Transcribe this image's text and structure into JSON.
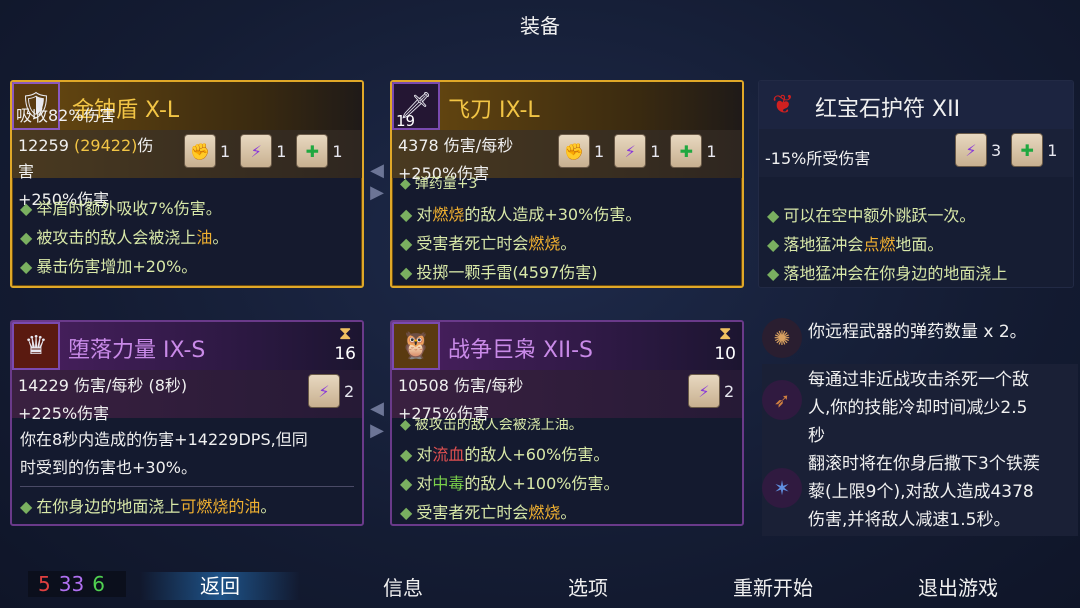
{
  "screen_title": "装备",
  "cards": {
    "shield": {
      "icon": "gold-shield-icon",
      "title": "金钟盾",
      "tier": "X-L",
      "overlay_text": "吸收82%伤害",
      "stat_base": "12259",
      "stat_boost": "(29422)",
      "stat_suffix": "伤",
      "stat_wrap": "害",
      "stat_line2": "+250%伤害",
      "scrolls": [
        {
          "icon": "scroll-red",
          "count": "1"
        },
        {
          "icon": "scroll-purple",
          "count": "1"
        },
        {
          "icon": "scroll-green",
          "count": "1"
        }
      ],
      "bullets": [
        {
          "pre": "举盾时额外吸收7%伤害。",
          "kw": "",
          "post": ""
        },
        {
          "pre": "被攻击的敌人会被浇上",
          "kw": "油",
          "post": "。"
        },
        {
          "pre": "暴击伤害增加+20%。",
          "kw": "",
          "post": ""
        }
      ]
    },
    "knife": {
      "icon": "throwing-knife-icon",
      "icon_count": "19",
      "title": "飞刀",
      "tier": "IX-L",
      "stat_line1": "4378 伤害/每秒",
      "stat_line2": "+250%伤害",
      "partial_bullet": "弹药量+3",
      "scrolls": [
        {
          "icon": "scroll-red",
          "count": "1"
        },
        {
          "icon": "scroll-purple",
          "count": "1"
        },
        {
          "icon": "scroll-green",
          "count": "1"
        }
      ],
      "bullets": [
        {
          "pre": "对",
          "kw": "燃烧",
          "post": "的敌人造成+30%伤害。"
        },
        {
          "pre": "受害者死亡时会",
          "kw": "燃烧",
          "post": "。"
        },
        {
          "pre": "投掷一颗手雷(4597伤害)",
          "kw": "",
          "post": ""
        }
      ]
    },
    "amulet": {
      "icon": "ruby-amulet-icon",
      "title": "红宝石护符",
      "tier": "XII",
      "stat_line1": "-15%所受伤害",
      "scrolls": [
        {
          "icon": "scroll-purple",
          "count": "3"
        },
        {
          "icon": "scroll-green",
          "count": "1"
        }
      ],
      "bullets": [
        {
          "pre": "可以在空中额外跳跃一次。",
          "kw": "",
          "post": ""
        },
        {
          "pre": "落地猛冲会",
          "kw": "点燃",
          "post": "地面。"
        },
        {
          "pre": "落地猛冲会在你身边的地面浇上",
          "kw": "",
          "post": ""
        }
      ]
    },
    "fallen": {
      "icon": "fallen-power-icon",
      "title": "堕落力量",
      "tier": "IX-S",
      "timer": "16",
      "stat_line1": "14229 伤害/每秒 (8秒)",
      "stat_line2": "+225%伤害",
      "scrolls": [
        {
          "icon": "scroll-purple",
          "count": "2"
        }
      ],
      "desc_line1": "你在8秒内造成的伤害+14229DPS,但同",
      "desc_line2": "时受到的伤害也+30%。",
      "bullets": [
        {
          "pre": "在你身边的地面浇上",
          "kw": "可燃烧的油",
          "post": "。"
        }
      ]
    },
    "owl": {
      "icon": "war-owl-icon",
      "title": "战争巨枭",
      "tier": "XII-S",
      "timer": "10",
      "stat_line1": "10508 伤害/每秒",
      "stat_line2": "+275%伤害",
      "partial_bullet": "被攻击的敌人会被浇上油。",
      "scrolls": [
        {
          "icon": "scroll-purple",
          "count": "2"
        }
      ],
      "bullets": [
        {
          "pre": "对",
          "kw": "流血",
          "post": "的敌人+60%伤害。",
          "kwclass": "kw-red"
        },
        {
          "pre": "对",
          "kw": "中毒",
          "post": "的敌人+100%伤害。",
          "kwclass": "kw-green"
        },
        {
          "pre": "受害者死亡时会",
          "kw": "燃烧",
          "post": "。"
        }
      ]
    }
  },
  "mutations": [
    {
      "icon": "ammo-icon",
      "lines": [
        "你远程武器的弹药数量 x 2。"
      ]
    },
    {
      "icon": "ranged-kill-icon",
      "lines": [
        "每通过非近战攻击杀死一个敌",
        "人,你的技能冷却时间减少2.5",
        "秒"
      ]
    },
    {
      "icon": "caltrops-icon",
      "lines": [
        "翻滚时将在你身后撒下3个铁蒺",
        "藜(上限9个),对敌人造成4378",
        "伤害,并将敌人减速1.5秒。"
      ]
    }
  ],
  "scroll_counts": {
    "red": "5",
    "purple": "33",
    "green": "6"
  },
  "menu": {
    "back": "返回",
    "info": "信息",
    "options": "选项",
    "restart": "重新开始",
    "quit": "退出游戏"
  },
  "colors": {
    "gold": "#e0a828",
    "purple": "#6a3a8a",
    "brutality": "#d02020",
    "tactics": "#8a3ad8",
    "survival": "#20a840"
  }
}
